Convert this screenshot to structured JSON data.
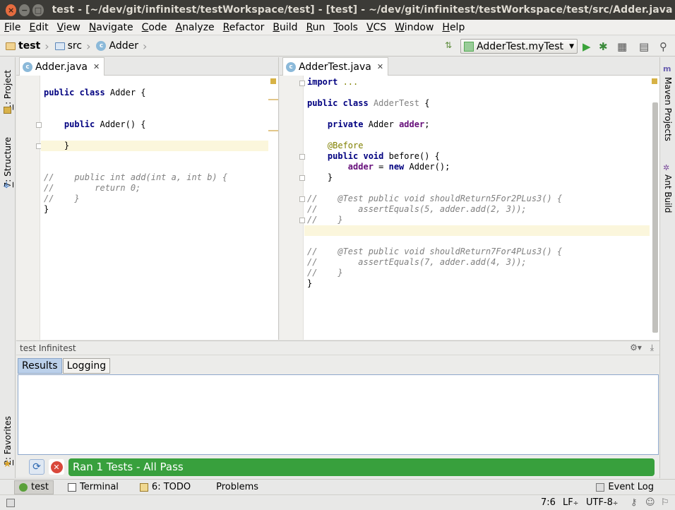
{
  "window": {
    "title": "test - [~/dev/git/infinitest/testWorkspace/test] - [test] - ~/dev/git/infinitest/testWorkspace/test/src/Adder.java - IntelliJ IDEA",
    "close_glyph": "×",
    "min_glyph": "−",
    "max_glyph": "□"
  },
  "menu": [
    "File",
    "Edit",
    "View",
    "Navigate",
    "Code",
    "Analyze",
    "Refactor",
    "Build",
    "Run",
    "Tools",
    "VCS",
    "Window",
    "Help"
  ],
  "breadcrumb": [
    "test",
    "src",
    "Adder"
  ],
  "run_config": {
    "label": "AdderTest.myTest"
  },
  "left_tools": [
    {
      "num": "1",
      "label": ": Project"
    },
    {
      "num": "7",
      "label": ": Structure"
    },
    {
      "num": "2",
      "label": ": Favorites"
    }
  ],
  "right_tools": [
    "Maven Projects",
    "Ant Build"
  ],
  "editor1": {
    "tab": "Adder.java",
    "lines": [
      {
        "parts": [
          {
            "t": "public class",
            "c": "kw"
          },
          {
            "t": " Adder {",
            "c": ""
          }
        ]
      },
      {
        "parts": [
          {
            "t": "    ",
            "c": ""
          },
          {
            "t": "public",
            "c": "kw"
          },
          {
            "t": " Adder() {",
            "c": ""
          }
        ]
      },
      {
        "parts": [
          {
            "t": "    }",
            "c": ""
          }
        ]
      },
      {
        "parts": [
          {
            "t": "//    public int add(int a, int b) {",
            "c": "cm"
          }
        ]
      },
      {
        "parts": [
          {
            "t": "//        return 0;",
            "c": "cm"
          }
        ]
      },
      {
        "parts": [
          {
            "t": "//    }",
            "c": "cm"
          }
        ]
      },
      {
        "parts": [
          {
            "t": "}",
            "c": ""
          }
        ]
      }
    ]
  },
  "editor2": {
    "tab": "AdderTest.java",
    "lines": [
      {
        "parts": [
          {
            "t": "import",
            "c": "kw"
          },
          {
            "t": " ...",
            "c": "an"
          }
        ]
      },
      {
        "parts": [
          {
            "t": "public class",
            "c": "kw"
          },
          {
            "t": " ",
            "c": ""
          },
          {
            "t": "AdderTest",
            "c": "unused"
          },
          {
            "t": " {",
            "c": ""
          }
        ]
      },
      {
        "parts": [
          {
            "t": "    ",
            "c": ""
          },
          {
            "t": "private",
            "c": "kw"
          },
          {
            "t": " Adder ",
            "c": ""
          },
          {
            "t": "adder",
            "c": "fld"
          },
          {
            "t": ";",
            "c": ""
          }
        ]
      },
      {
        "parts": [
          {
            "t": "    ",
            "c": ""
          },
          {
            "t": "@Before",
            "c": "an"
          }
        ]
      },
      {
        "parts": [
          {
            "t": "    ",
            "c": ""
          },
          {
            "t": "public void",
            "c": "kw"
          },
          {
            "t": " before() {",
            "c": ""
          }
        ]
      },
      {
        "parts": [
          {
            "t": "        ",
            "c": ""
          },
          {
            "t": "adder",
            "c": "fld"
          },
          {
            "t": " = ",
            "c": ""
          },
          {
            "t": "new",
            "c": "kw"
          },
          {
            "t": " Adder();",
            "c": ""
          }
        ]
      },
      {
        "parts": [
          {
            "t": "    }",
            "c": ""
          }
        ]
      },
      {
        "parts": [
          {
            "t": "//    @Test public void shouldReturn5For2PLus3() {",
            "c": "cm"
          }
        ]
      },
      {
        "parts": [
          {
            "t": "//        assertEquals(5, adder.add(2, 3));",
            "c": "cm"
          }
        ]
      },
      {
        "parts": [
          {
            "t": "//    }",
            "c": "cm"
          }
        ]
      },
      {
        "parts": [
          {
            "t": "//    @Test public void shouldReturn7For4PLus3() {",
            "c": "cm"
          }
        ]
      },
      {
        "parts": [
          {
            "t": "//        assertEquals(7, adder.add(4, 3));",
            "c": "cm"
          }
        ]
      },
      {
        "parts": [
          {
            "t": "//    }",
            "c": "cm"
          }
        ]
      },
      {
        "parts": [
          {
            "t": "}",
            "c": ""
          }
        ]
      }
    ]
  },
  "toolwindow": {
    "title": "test Infinitest",
    "tabs": [
      "Results",
      "Logging"
    ],
    "status": "Ran 1 Tests - All Pass",
    "status_color": "#38a03d"
  },
  "bottom_tools": [
    {
      "label": "test",
      "icon": "infinitest-icon"
    },
    {
      "label": "Terminal",
      "icon": "terminal-icon"
    },
    {
      "label": "6: TODO",
      "icon": "todo-icon"
    },
    {
      "label": "Problems",
      "icon": "problems-icon"
    }
  ],
  "event_log": "Event Log",
  "status": {
    "position": "7:6",
    "line_sep": "LF",
    "encoding": "UTF-8"
  }
}
